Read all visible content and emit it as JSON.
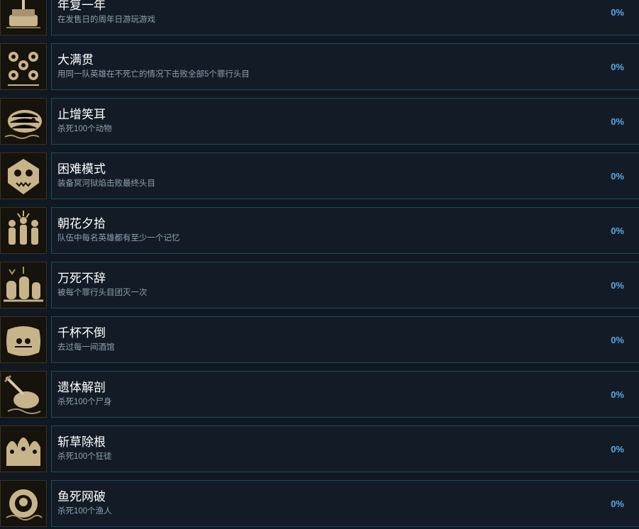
{
  "achievements": [
    {
      "title": "年复一年",
      "desc": "在发售日的周年日游玩游戏",
      "pct": "0%",
      "icon": "cake-icon"
    },
    {
      "title": "大满贯",
      "desc": "用同一队英雄在不死亡的情况下击败全部5个罪行头目",
      "pct": "0%",
      "icon": "flames-icon"
    },
    {
      "title": "止增笑耳",
      "desc": "杀死100个动物",
      "pct": "0%",
      "icon": "beast-icon"
    },
    {
      "title": "困难模式",
      "desc": "装备冥河狱焰击败最终头目",
      "pct": "0%",
      "icon": "demon-face-icon"
    },
    {
      "title": "朝花夕拾",
      "desc": "队伍中每名英雄都有至少一个记忆",
      "pct": "0%",
      "icon": "party-icon"
    },
    {
      "title": "万死不辞",
      "desc": "被每个罪行头目团灭一次",
      "pct": "0%",
      "icon": "graves-icon"
    },
    {
      "title": "千杯不倒",
      "desc": "去过每一间酒馆",
      "pct": "0%",
      "icon": "pillow-icon"
    },
    {
      "title": "遗体解剖",
      "desc": "杀死100个尸身",
      "pct": "0%",
      "icon": "corpse-dagger-icon"
    },
    {
      "title": "斩草除根",
      "desc": "杀死100个狂徒",
      "pct": "0%",
      "icon": "cultists-icon"
    },
    {
      "title": "鱼死网破",
      "desc": "杀死100个渔人",
      "pct": "0%",
      "icon": "fishman-icon"
    }
  ],
  "colors": {
    "background": "#101822",
    "card_border": "#1f4a62",
    "percent": "#5aa9e6",
    "icon_gold": "#c8b48a"
  }
}
